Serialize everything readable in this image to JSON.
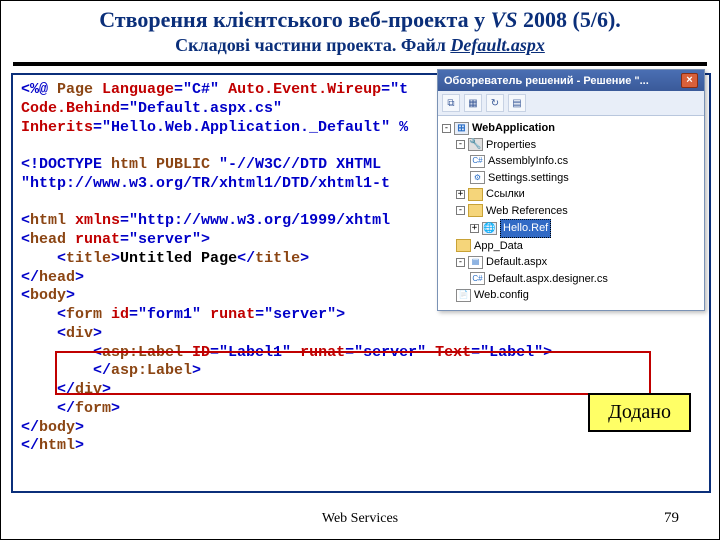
{
  "title": {
    "prefix": "Створення клієнтського веб-проекта у ",
    "vs": "VS",
    "suffix": " 2008 (5/6)."
  },
  "subtitle": {
    "prefix": "Складові частини проекта. Файл ",
    "filename": "Default.aspx"
  },
  "panel": {
    "title": "Обозреватель решений - Решение \"...",
    "close": "×",
    "tree": {
      "root": "WebApplication",
      "properties": "Properties",
      "assembly": "AssemblyInfo.cs",
      "settings": "Settings.settings",
      "references": "Ссылки",
      "webrefs": "Web References",
      "helloref": "Hello.Ref",
      "appdata": "App_Data",
      "defaultaspx": "Default.aspx",
      "designer": "Default.aspx.designer.cs",
      "webconfig": "Web.config"
    }
  },
  "badge": "Додано",
  "footer": "Web Services",
  "pagenum": "79",
  "code": {
    "l1a": "<%@",
    "l1b": " Page ",
    "l1c": "Language",
    "l1d": "=\"C#\"",
    "l1e": " Auto.Event.Wireup",
    "l1f": "=\"t",
    "l2a": "Code.Behind",
    "l2b": "=\"Default.aspx.cs\"",
    "l3a": "Inherits",
    "l3b": "=\"Hello.Web.Application._Default\"",
    "l3c": " %",
    "l5a": "<!DOCTYPE",
    "l5b": " html ",
    "l5c": "PUBLIC",
    "l5d": " \"-//W3C//DTD XHTML",
    "l6": "\"http://www.w3.org/TR/xhtml1/DTD/xhtml1-t",
    "l8a": "<",
    "l8html": "html",
    "l8b": " xmlns",
    "l8c": "=\"http://www.w3.org/1999/xhtml",
    "l9a": "<",
    "l9head": "head",
    "l9b": " runat",
    "l9c": "=\"server\">",
    "l10a": "    <",
    "l10title": "title",
    "l10b": ">",
    "l10c": "Untitled Page",
    "l10d": "</",
    "l10e": ">",
    "l11a": "</",
    "l11b": ">",
    "l12a": "<",
    "l12body": "body",
    "l12b": ">",
    "l13a": "    <",
    "l13form": "form",
    "l13b": " id",
    "l13c": "=\"form1\"",
    "l13d": " runat",
    "l13e": "=\"server\">",
    "l14a": "    <",
    "l14div": "div",
    "l14b": ">",
    "l15a": "        <",
    "l15asp": "asp:Label",
    "l15b": " ID",
    "l15c": "=\"Label1\"",
    "l15d": " runat",
    "l15e": "=\"server\"",
    "l15f": " Text",
    "l15g": "=\"Label\">",
    "l16a": "        </",
    "l16b": ">",
    "l17a": "    </",
    "l17b": ">",
    "l18a": "    </",
    "l18b": ">",
    "l19a": "</",
    "l19b": ">",
    "l20a": "</",
    "l20b": ">"
  }
}
